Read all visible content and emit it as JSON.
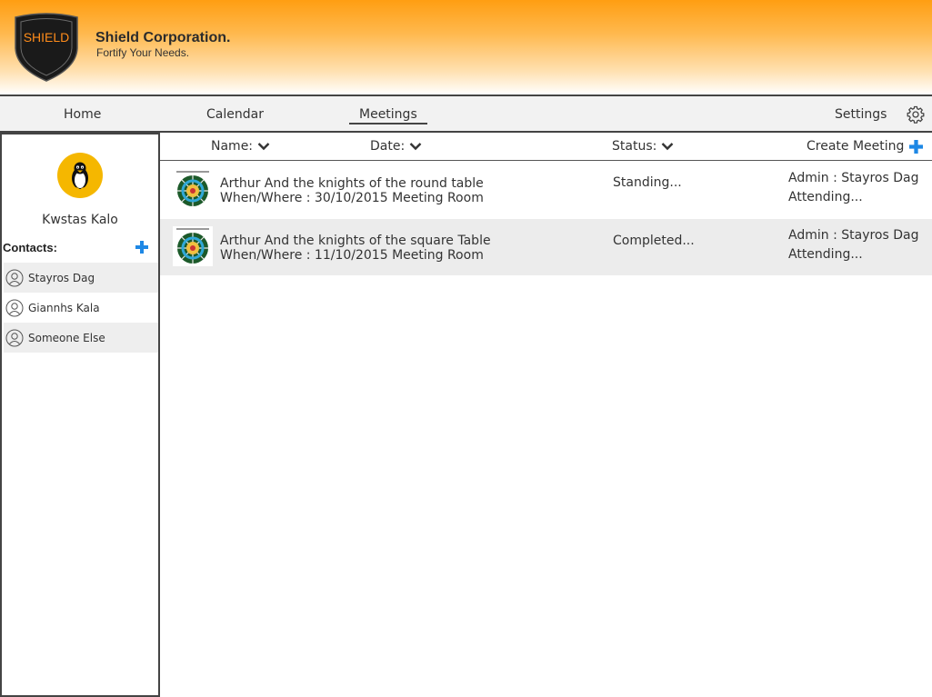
{
  "brand": {
    "logo_text": "SHIELD",
    "name": "Shield Corporation.",
    "tagline": "Fortify Your Needs."
  },
  "nav": {
    "home": "Home",
    "calendar": "Calendar",
    "meetings": "Meetings",
    "settings": "Settings",
    "active": "Meetings"
  },
  "user": {
    "name": "Kwstas Kalo",
    "avatar_icon": "linux-penguin-icon"
  },
  "contacts": {
    "label": "Contacts:",
    "items": [
      {
        "name": "Stayros Dag"
      },
      {
        "name": "Giannhs Kala"
      },
      {
        "name": "Someone Else"
      }
    ]
  },
  "table": {
    "columns": {
      "name": "Name:",
      "date": "Date:",
      "status": "Status:",
      "create": "Create Meeting"
    },
    "rows": [
      {
        "title": "Arthur And the knights of the round table",
        "when_where": "When/Where : 30/10/2015 Meeting Room",
        "status": "Standing...",
        "admin": "Admin : Stayros Dag",
        "attending": "Attending..."
      },
      {
        "title": "Arthur And the knights of the square Table",
        "when_where": "When/Where : 11/10/2015 Meeting Room",
        "status": "Completed...",
        "admin": "Admin : Stayros Dag",
        "attending": "Attending..."
      }
    ]
  },
  "colors": {
    "accent_orange": "#ff9e12",
    "avatar_yellow": "#f5b700",
    "plus_blue": "#1e88e5",
    "logo_text_orange": "#ff8c1a"
  }
}
